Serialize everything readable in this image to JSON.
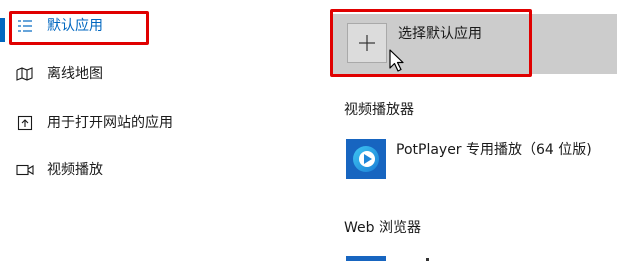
{
  "sidebar": {
    "items": [
      {
        "label": "默认应用",
        "icon": "default-apps-icon",
        "active": true
      },
      {
        "label": "离线地图",
        "icon": "offline-maps-icon",
        "active": false
      },
      {
        "label": "用于打开网站的应用",
        "icon": "apps-for-websites-icon",
        "active": false
      },
      {
        "label": "视频播放",
        "icon": "video-playback-icon",
        "active": false
      }
    ]
  },
  "main": {
    "choose_default": {
      "label": "选择默认应用",
      "icon": "plus-icon"
    },
    "sections": [
      {
        "heading": "视频播放器",
        "app": {
          "name": "PotPlayer 专用播放（64 位版)",
          "icon": "potplayer-icon"
        }
      },
      {
        "heading": "Web 浏览器",
        "app": {
          "name": "",
          "icon": "browser-icon"
        }
      }
    ]
  },
  "colors": {
    "accent": "#0067c0",
    "highlight_box": "#e00000",
    "button_bg": "#cccccc",
    "app_tile": "#1765c0"
  }
}
